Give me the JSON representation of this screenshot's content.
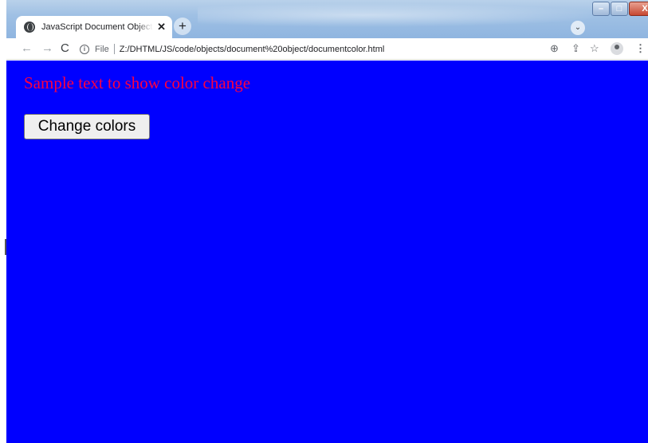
{
  "browser": {
    "tab": {
      "title": "JavaScript Document Object Exa",
      "close_glyph": "✕",
      "favicon": "globe-icon"
    },
    "new_tab_glyph": "+",
    "tab_search_glyph": "⌄",
    "window_controls": {
      "minimize": "–",
      "maximize": "□",
      "close": "X"
    },
    "nav": {
      "back": "←",
      "forward": "→",
      "reload": "C"
    },
    "address": {
      "info_glyph": "i",
      "scheme_label": "File",
      "url": "Z:/DHTML/JS/code/objects/document%20object/documentcolor.html"
    },
    "toolbar_icons": {
      "zoom": "⊕",
      "share": "⇪",
      "bookmark": "☆",
      "profile": "profile-icon",
      "menu": "⋮"
    }
  },
  "page": {
    "background_color": "#0000ff",
    "sample_text": "Sample text to show color change",
    "sample_text_color": "#ff0040",
    "button_label": "Change colors"
  }
}
